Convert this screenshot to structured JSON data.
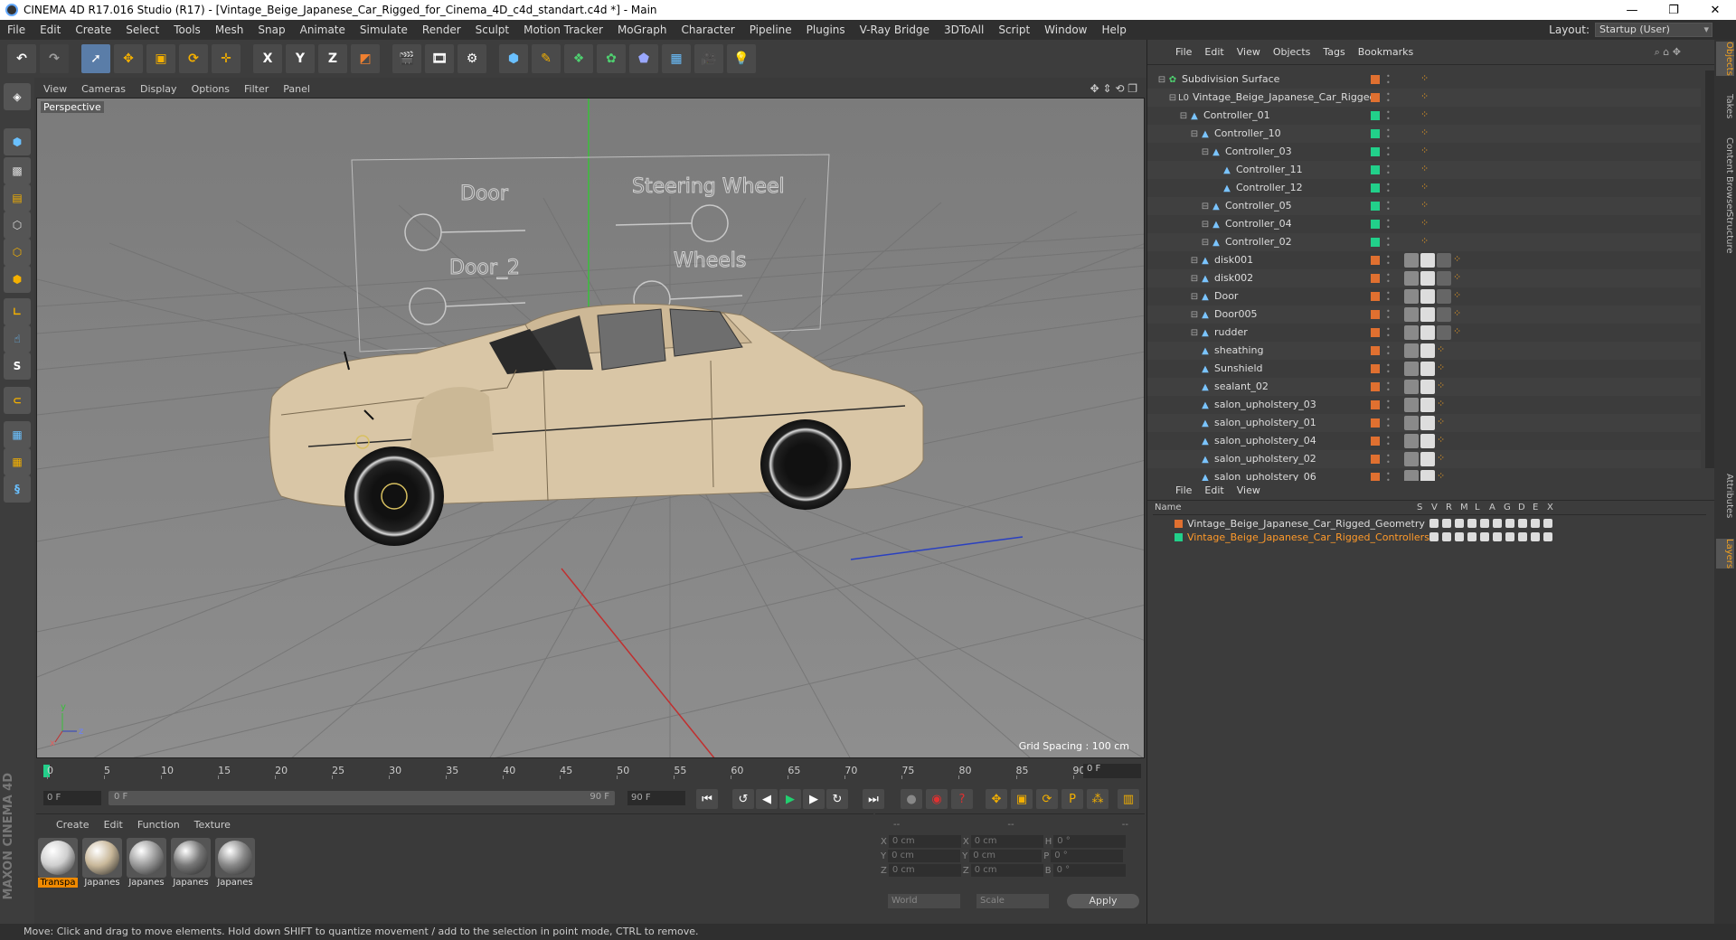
{
  "window": {
    "title": "CINEMA 4D R17.016 Studio (R17) - [Vintage_Beige_Japanese_Car_Rigged_for_Cinema_4D_c4d_standart.c4d *] - Main",
    "controls": [
      "—",
      "❐",
      "✕"
    ]
  },
  "menubar": {
    "items": [
      "File",
      "Edit",
      "Create",
      "Select",
      "Tools",
      "Mesh",
      "Snap",
      "Animate",
      "Simulate",
      "Render",
      "Sculpt",
      "Motion Tracker",
      "MoGraph",
      "Character",
      "Pipeline",
      "Plugins",
      "V-Ray Bridge",
      "3DToAll",
      "Script",
      "Window",
      "Help"
    ],
    "layout_label": "Layout:",
    "layout_value": "Startup (User)"
  },
  "toolbar": {
    "axis_x": "X",
    "axis_y": "Y",
    "axis_z": "Z"
  },
  "lefttools": {
    "snap_s": "S"
  },
  "viewport": {
    "menu": [
      "View",
      "Cameras",
      "Display",
      "Options",
      "Filter",
      "Panel"
    ],
    "label": "Perspective",
    "grid_spacing": "Grid Spacing : 100 cm",
    "overlay_labels": [
      "Door",
      "Steering Wheel",
      "Door_2",
      "Wheels"
    ],
    "axis_y": "y",
    "axis_z": "z",
    "axis_x": "x"
  },
  "timeline": {
    "ticks": [
      "0",
      "5",
      "10",
      "15",
      "20",
      "25",
      "30",
      "35",
      "40",
      "45",
      "50",
      "55",
      "60",
      "65",
      "70",
      "75",
      "80",
      "85",
      "90"
    ],
    "current": "0 F"
  },
  "playbar": {
    "start": "0 F",
    "range_start": "0 F",
    "range_end": "90 F",
    "end": "90 F"
  },
  "materials": {
    "menu": [
      "Create",
      "Edit",
      "Function",
      "Texture"
    ],
    "items": [
      {
        "label": "Transpa",
        "color": "#cfcfcf",
        "active": true
      },
      {
        "label": "Japanes",
        "color": "#c9b89a",
        "active": false
      },
      {
        "label": "Japanes",
        "color": "#9a9a9a",
        "active": false
      },
      {
        "label": "Japanes",
        "color": "#777777",
        "active": false
      },
      {
        "label": "Japanes",
        "color": "#888888",
        "active": false
      }
    ]
  },
  "coordinates": {
    "header": [
      "--",
      "--",
      "--"
    ],
    "rows": [
      {
        "a": "X",
        "av": "0 cm",
        "b": "X",
        "bv": "0 cm",
        "c": "H",
        "cv": "0 °"
      },
      {
        "a": "Y",
        "av": "0 cm",
        "b": "Y",
        "bv": "0 cm",
        "c": "P",
        "cv": "0 °"
      },
      {
        "a": "Z",
        "av": "0 cm",
        "b": "Z",
        "bv": "0 cm",
        "c": "B",
        "cv": "0 °"
      }
    ],
    "space": "World",
    "mode": "Scale",
    "apply": "Apply"
  },
  "objects": {
    "menu": [
      "File",
      "Edit",
      "View",
      "Objects",
      "Tags",
      "Bookmarks"
    ],
    "rows": [
      {
        "name": "Subdivision Surface",
        "indent": 0,
        "color": "#e07030"
      },
      {
        "name": "Vintage_Beige_Japanese_Car_Rigged",
        "indent": 1,
        "color": "#e07030"
      },
      {
        "name": "Controller_01",
        "indent": 2,
        "color": "#22d08a"
      },
      {
        "name": "Controller_10",
        "indent": 3,
        "color": "#22d08a"
      },
      {
        "name": "Controller_03",
        "indent": 4,
        "color": "#22d08a"
      },
      {
        "name": "Controller_11",
        "indent": 5,
        "color": "#22d08a"
      },
      {
        "name": "Controller_12",
        "indent": 5,
        "color": "#22d08a"
      },
      {
        "name": "Controller_05",
        "indent": 4,
        "color": "#22d08a"
      },
      {
        "name": "Controller_04",
        "indent": 4,
        "color": "#22d08a"
      },
      {
        "name": "Controller_02",
        "indent": 4,
        "color": "#22d08a"
      },
      {
        "name": "disk001",
        "indent": 3,
        "color": "#e07030"
      },
      {
        "name": "disk002",
        "indent": 3,
        "color": "#e07030"
      },
      {
        "name": "Door",
        "indent": 3,
        "color": "#e07030"
      },
      {
        "name": "Door005",
        "indent": 3,
        "color": "#e07030"
      },
      {
        "name": "rudder",
        "indent": 3,
        "color": "#e07030"
      },
      {
        "name": "sheathing",
        "indent": 3,
        "color": "#e07030"
      },
      {
        "name": "Sunshield",
        "indent": 3,
        "color": "#e07030"
      },
      {
        "name": "sealant_02",
        "indent": 3,
        "color": "#e07030"
      },
      {
        "name": "salon_upholstery_03",
        "indent": 3,
        "color": "#e07030"
      },
      {
        "name": "salon_upholstery_01",
        "indent": 3,
        "color": "#e07030"
      },
      {
        "name": "salon_upholstery_04",
        "indent": 3,
        "color": "#e07030"
      },
      {
        "name": "salon_upholstery_02",
        "indent": 3,
        "color": "#e07030"
      },
      {
        "name": "salon_upholstery_06",
        "indent": 3,
        "color": "#e07030"
      }
    ]
  },
  "layers": {
    "menu": [
      "File",
      "Edit",
      "View"
    ],
    "header": [
      "Name",
      "S",
      "V",
      "R",
      "M",
      "L",
      "A",
      "G",
      "D",
      "E",
      "X"
    ],
    "rows": [
      {
        "name": "Vintage_Beige_Japanese_Car_Rigged_Geometry",
        "color": "#e07030",
        "text_color": "#dddddd"
      },
      {
        "name": "Vintage_Beige_Japanese_Car_Rigged_Controllers",
        "color": "#22d08a",
        "text_color": "#ff9a2a"
      }
    ]
  },
  "side_tabs": [
    "Objects",
    "Takes",
    "Content Browser",
    "Structure",
    "Attributes",
    "Layers"
  ],
  "status": "Move: Click and drag to move elements. Hold down SHIFT to quantize movement / add to the selection in point mode, CTRL to remove."
}
